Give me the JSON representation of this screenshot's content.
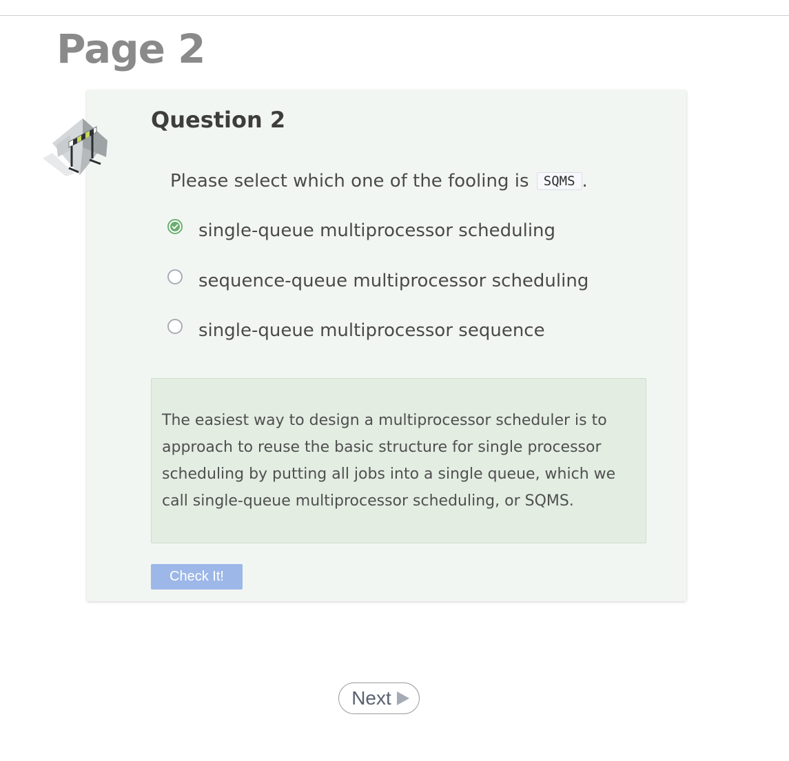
{
  "page": {
    "title": "Page 2"
  },
  "question": {
    "title": "Question 2",
    "icon": "construction-barrier-icon",
    "prompt_prefix": "Please select which one of the fooling is",
    "prompt_code": "SQMS",
    "prompt_suffix": ".",
    "options": [
      {
        "label": "single-queue multiprocessor scheduling",
        "selected": true
      },
      {
        "label": "sequence-queue multiprocessor scheduling",
        "selected": false
      },
      {
        "label": "single-queue multiprocessor sequence",
        "selected": false
      }
    ],
    "feedback": "The easiest way to design a multiprocessor scheduler is to approach to reuse the basic structure for single processor scheduling by putting all jobs into a single queue, which we call single-queue multiprocessor scheduling, or SQMS."
  },
  "buttons": {
    "check": "Check It!",
    "next": "Next"
  },
  "colors": {
    "selected_radio": "#6aae6f",
    "check_button": "#9cb7e8",
    "card_background": "#f2f6f2",
    "feedback_background": "#e3ede2"
  }
}
